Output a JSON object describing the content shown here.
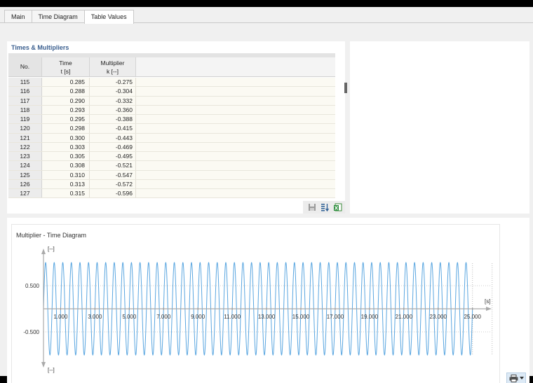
{
  "tabs": [
    {
      "label": "Main",
      "active": false
    },
    {
      "label": "Time Diagram",
      "active": false
    },
    {
      "label": "Table Values",
      "active": true
    }
  ],
  "table": {
    "title": "Times & Multipliers",
    "headers": {
      "no": "No.",
      "t_line1": "Time",
      "t_line2": "t [s]",
      "k_line1": "Multiplier",
      "k_line2": "k [--]"
    },
    "rows": [
      {
        "no": "115",
        "t": "0.285",
        "k": "-0.275"
      },
      {
        "no": "116",
        "t": "0.288",
        "k": "-0.304"
      },
      {
        "no": "117",
        "t": "0.290",
        "k": "-0.332"
      },
      {
        "no": "118",
        "t": "0.293",
        "k": "-0.360"
      },
      {
        "no": "119",
        "t": "0.295",
        "k": "-0.388"
      },
      {
        "no": "120",
        "t": "0.298",
        "k": "-0.415"
      },
      {
        "no": "121",
        "t": "0.300",
        "k": "-0.443"
      },
      {
        "no": "122",
        "t": "0.303",
        "k": "-0.469"
      },
      {
        "no": "123",
        "t": "0.305",
        "k": "-0.495"
      },
      {
        "no": "124",
        "t": "0.308",
        "k": "-0.521"
      },
      {
        "no": "125",
        "t": "0.310",
        "k": "-0.547"
      },
      {
        "no": "126",
        "t": "0.313",
        "k": "-0.572"
      },
      {
        "no": "127",
        "t": "0.315",
        "k": "-0.596"
      }
    ]
  },
  "chart_data": {
    "type": "line",
    "title": "Multiplier - Time Diagram",
    "xunit": "[s]",
    "yunit_top": "[--]",
    "yunit_bottom": "[--]",
    "x_ticks": [
      "1.000",
      "3.000",
      "5.000",
      "7.000",
      "9.000",
      "11.000",
      "13.000",
      "15.000",
      "17.000",
      "19.000",
      "21.000",
      "23.000",
      "25.000"
    ],
    "x_tick_values": [
      1,
      3,
      5,
      7,
      9,
      11,
      13,
      15,
      17,
      19,
      21,
      23,
      25
    ],
    "y_ticks": [
      "0.500",
      "-0.500"
    ],
    "y_tick_values": [
      0.5,
      -0.5
    ],
    "xlim": [
      0,
      26
    ],
    "ylim": [
      -1,
      1
    ],
    "series": [
      {
        "function": "sin",
        "amplitude": 1.0,
        "frequency_hz": 2.0,
        "t_start": 0,
        "t_end": 25,
        "color": "#5aa6e0"
      }
    ],
    "grid": "dotted at tick positions",
    "axis_color": "#aaaaaa"
  },
  "colors": {
    "accent": "#3b5f8f",
    "line": "#5aa6e0"
  },
  "icons": [
    "save-icon",
    "sort-icon",
    "export-excel-icon",
    "printer-icon",
    "chevron-down-icon"
  ]
}
